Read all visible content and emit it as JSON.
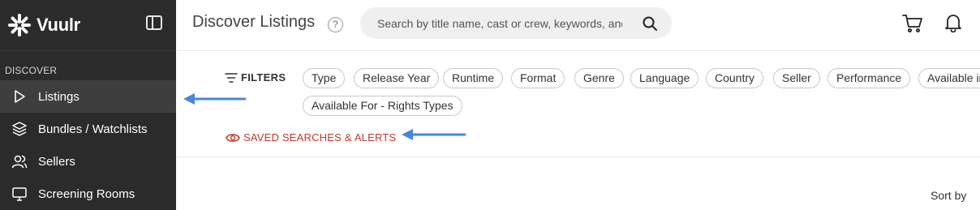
{
  "brand": {
    "name": "Vuulr"
  },
  "sidebar": {
    "section_label": "DISCOVER",
    "items": [
      {
        "label": "Listings",
        "icon": "play-icon",
        "active": true
      },
      {
        "label": "Bundles / Watchlists",
        "icon": "layers-icon",
        "active": false
      },
      {
        "label": "Sellers",
        "icon": "users-icon",
        "active": false
      },
      {
        "label": "Screening Rooms",
        "icon": "monitor-icon",
        "active": false
      }
    ]
  },
  "header": {
    "title": "Discover Listings",
    "help_symbol": "?",
    "search": {
      "placeholder": "Search by title name, cast or crew, keywords, and more"
    }
  },
  "filters": {
    "label": "FILTERS",
    "chips": [
      "Type",
      "Release Year",
      "Runtime",
      "Format",
      "Genre",
      "Language",
      "Country",
      "Seller",
      "Performance",
      "Available in",
      "Available For - Rights Types"
    ]
  },
  "saved_searches": {
    "label": "SAVED SEARCHES & ALERTS"
  },
  "results": {
    "sort_label": "Sort by"
  },
  "colors": {
    "sidebar_bg": "#2b2b2b",
    "accent_red": "#c0392b",
    "annotation_blue": "#4a86e0"
  }
}
